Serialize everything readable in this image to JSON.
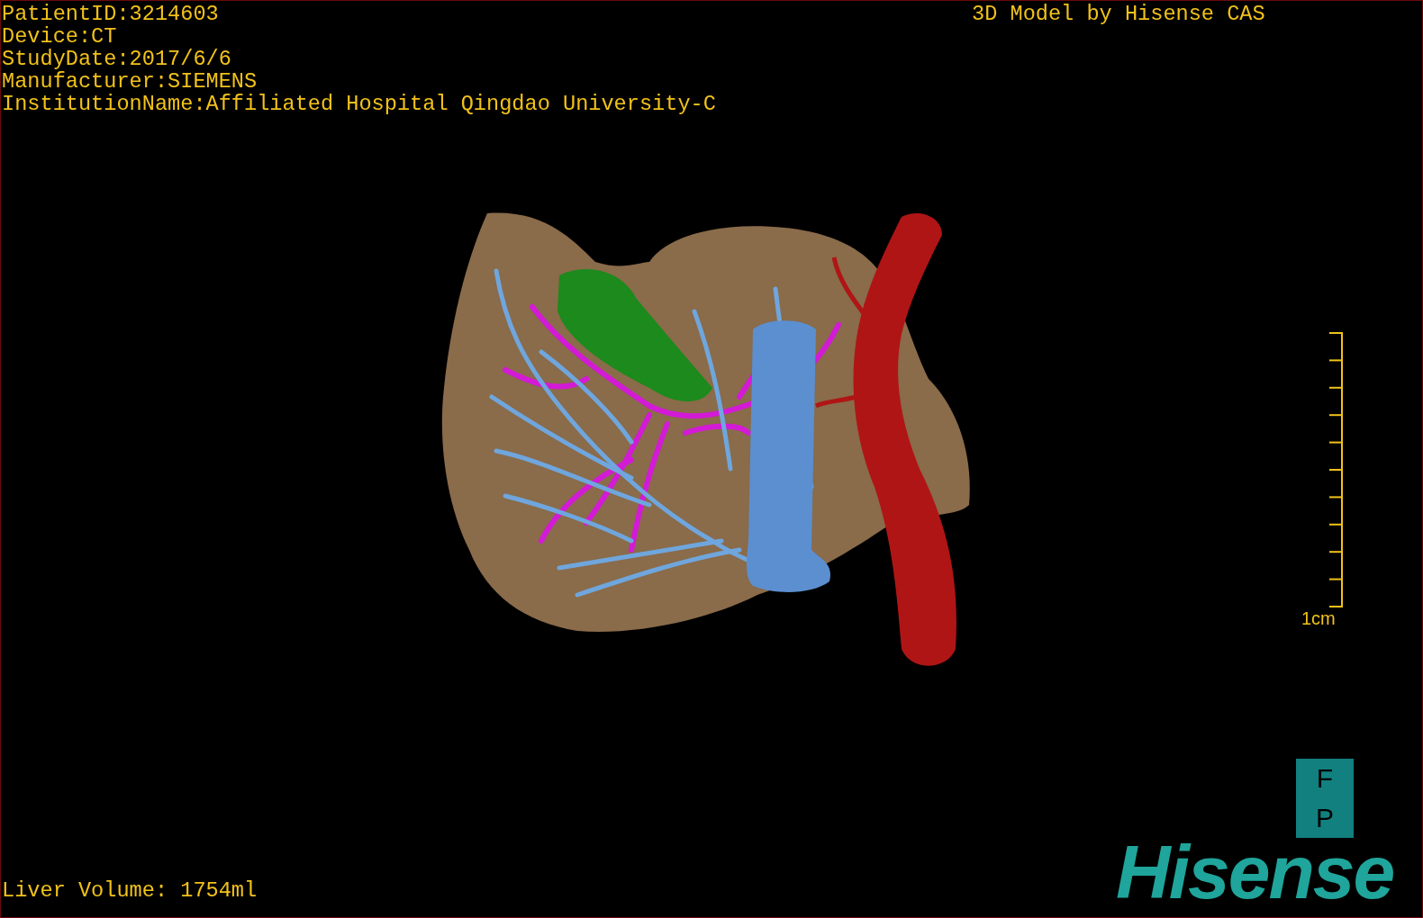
{
  "patient_info": [
    "PatientID:3214603",
    "Device:CT",
    "StudyDate:2017/6/6",
    "Manufacturer:SIEMENS",
    "InstitutionName:Affiliated Hospital Qingdao University-C"
  ],
  "model_title": "3D Model by Hisense CAS",
  "scale_bar": {
    "label": "1cm"
  },
  "liver_volume": "Liver Volume: 1754ml",
  "logo": {
    "box_letters": [
      "F",
      "P"
    ],
    "wordmark": "Hisense"
  }
}
